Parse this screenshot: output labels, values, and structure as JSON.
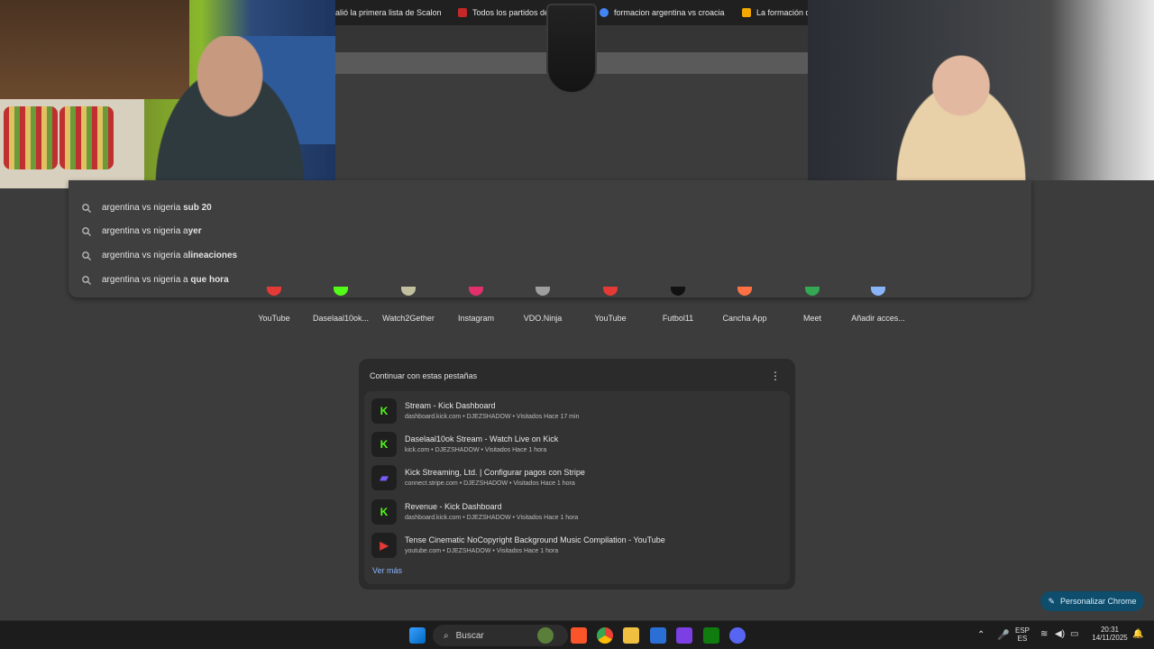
{
  "tabs": [
    {
      "title": "alió la primera lista de Scalon",
      "favicon_color": "#3c3c3c"
    },
    {
      "title": "Todos los partidos de la",
      "favicon_color": "#c62828"
    },
    {
      "title": "formacion argentina vs croacia",
      "favicon_color": "#4285f4"
    },
    {
      "title": "La formación de",
      "favicon_color": "#f2a900"
    }
  ],
  "suggestions": [
    {
      "prefix": "argentina vs nigeria ",
      "bold": "sub 20"
    },
    {
      "prefix": "argentina vs nigeria a",
      "bold": "yer"
    },
    {
      "prefix": "argentina vs nigeria a",
      "bold": "lineaciones"
    },
    {
      "prefix": "argentina vs nigeria a ",
      "bold": "que hora"
    }
  ],
  "shortcuts": [
    {
      "label": "YouTube",
      "color": "#e53935"
    },
    {
      "label": "Daselaal10ok...",
      "color": "#53fc18"
    },
    {
      "label": "Watch2Gether",
      "color": "#c0c0a0"
    },
    {
      "label": "Instagram",
      "color": "#e1306c"
    },
    {
      "label": "VDO.Ninja",
      "color": "#9e9e9e"
    },
    {
      "label": "YouTube",
      "color": "#e53935"
    },
    {
      "label": "Futbol11",
      "color": "#111111"
    },
    {
      "label": "Cancha App",
      "color": "#ff7043"
    },
    {
      "label": "Meet",
      "color": "#34a853"
    },
    {
      "label": "Añadir acces...",
      "color": "#8ab4f8"
    }
  ],
  "continue_card": {
    "title": "Continuar con estas pestañas",
    "items": [
      {
        "title": "Stream - Kick Dashboard",
        "subtitle": "dashboard.kick.com • DJEZSHADOW • Visitados Hace 17 min",
        "icon": "kick-icon",
        "icon_text": "K",
        "icon_color": "#53fc18"
      },
      {
        "title": "Daselaal10ok Stream - Watch Live on Kick",
        "subtitle": "kick.com • DJEZSHADOW • Visitados Hace 1 hora",
        "icon": "kick-icon",
        "icon_text": "K",
        "icon_color": "#53fc18"
      },
      {
        "title": "Kick Streaming, Ltd. | Configurar pagos con Stripe",
        "subtitle": "connect.stripe.com • DJEZSHADOW • Visitados Hace 1 hora",
        "icon": "stripe-icon",
        "icon_text": "▰",
        "icon_color": "#7a5af8"
      },
      {
        "title": "Revenue - Kick Dashboard",
        "subtitle": "dashboard.kick.com • DJEZSHADOW • Visitados Hace 1 hora",
        "icon": "kick-icon",
        "icon_text": "K",
        "icon_color": "#53fc18"
      },
      {
        "title": "Tense Cinematic NoCopyright Background Music Compilation - YouTube",
        "subtitle": "youtube.com • DJEZSHADOW • Visitados Hace 1 hora",
        "icon": "youtube-icon",
        "icon_text": "▶",
        "icon_color": "#e53935"
      }
    ],
    "more_label": "Ver más"
  },
  "customize_label": "Personalizar Chrome",
  "taskbar": {
    "search_label": "Buscar",
    "lang_top": "ESP",
    "lang_bottom": "ES",
    "time": "20:31",
    "date": "14/11/2025"
  }
}
